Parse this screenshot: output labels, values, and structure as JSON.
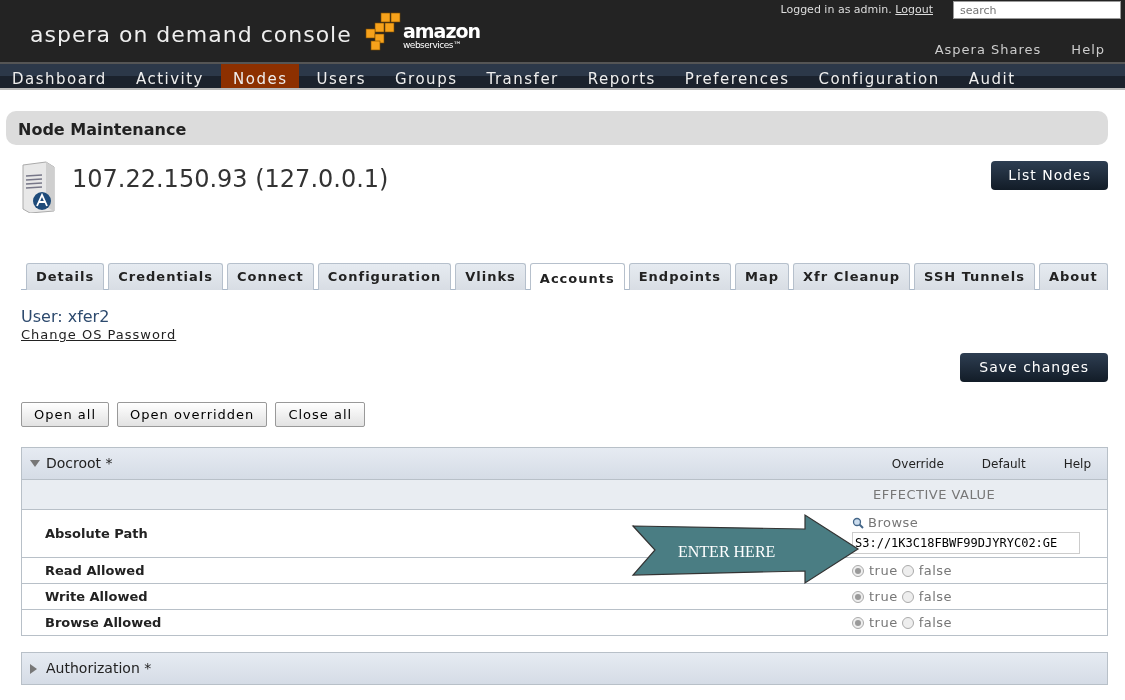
{
  "header": {
    "title": "aspera on demand console",
    "logo_word": "amazon",
    "logo_sub": "webservices™",
    "login_text": "Logged in as admin.",
    "logout": "Logout",
    "search": {
      "placeholder": "search"
    },
    "links": [
      "Aspera Shares",
      "Help"
    ]
  },
  "nav": [
    {
      "label": "Dashboard",
      "selected": false
    },
    {
      "label": "Activity",
      "selected": false
    },
    {
      "label": "Nodes",
      "selected": true
    },
    {
      "label": "Users",
      "selected": false
    },
    {
      "label": "Groups",
      "selected": false
    },
    {
      "label": "Transfer",
      "selected": false
    },
    {
      "label": "Reports",
      "selected": false
    },
    {
      "label": "Preferences",
      "selected": false
    },
    {
      "label": "Configuration",
      "selected": false
    },
    {
      "label": "Audit",
      "selected": false
    }
  ],
  "page_title": "Node Maintenance",
  "node_title": "107.22.150.93 (127.0.0.1)",
  "list_button": "List Nodes",
  "tabs": [
    {
      "label": "Details",
      "selected": false
    },
    {
      "label": "Credentials",
      "selected": false
    },
    {
      "label": "Connect",
      "selected": false
    },
    {
      "label": "Configuration",
      "selected": false
    },
    {
      "label": "Vlinks",
      "selected": false
    },
    {
      "label": "Accounts",
      "selected": true
    },
    {
      "label": "Endpoints",
      "selected": false
    },
    {
      "label": "Map",
      "selected": false
    },
    {
      "label": "Xfr Cleanup",
      "selected": false
    },
    {
      "label": "SSH Tunnels",
      "selected": false
    },
    {
      "label": "About",
      "selected": false
    }
  ],
  "user": "User: xfer2",
  "change_password": "Change OS Password",
  "save_button": "Save changes",
  "toggle_buttons": [
    "Open all",
    "Open overridden",
    "Close all"
  ],
  "sections": [
    {
      "title": "Docroot *",
      "expanded": true,
      "actions": [
        "Override",
        "Default",
        "Help"
      ],
      "column_header": "EFFECTIVE VALUE",
      "rows": [
        {
          "kind": "path",
          "label": "Absolute Path",
          "browse": "Browse",
          "value": "S3://1K3C18FBWF99DJYRYC02:GE"
        },
        {
          "kind": "bool",
          "label": "Read Allowed",
          "options": [
            {
              "label": "true",
              "selected": true
            },
            {
              "label": "false",
              "selected": false
            }
          ]
        },
        {
          "kind": "bool",
          "label": "Write Allowed",
          "options": [
            {
              "label": "true",
              "selected": true
            },
            {
              "label": "false",
              "selected": false
            }
          ]
        },
        {
          "kind": "bool",
          "label": "Browse Allowed",
          "options": [
            {
              "label": "true",
              "selected": true
            },
            {
              "label": "false",
              "selected": false
            }
          ]
        }
      ]
    },
    {
      "title": "Authorization *",
      "expanded": false
    }
  ],
  "callout": "ENTER HERE"
}
